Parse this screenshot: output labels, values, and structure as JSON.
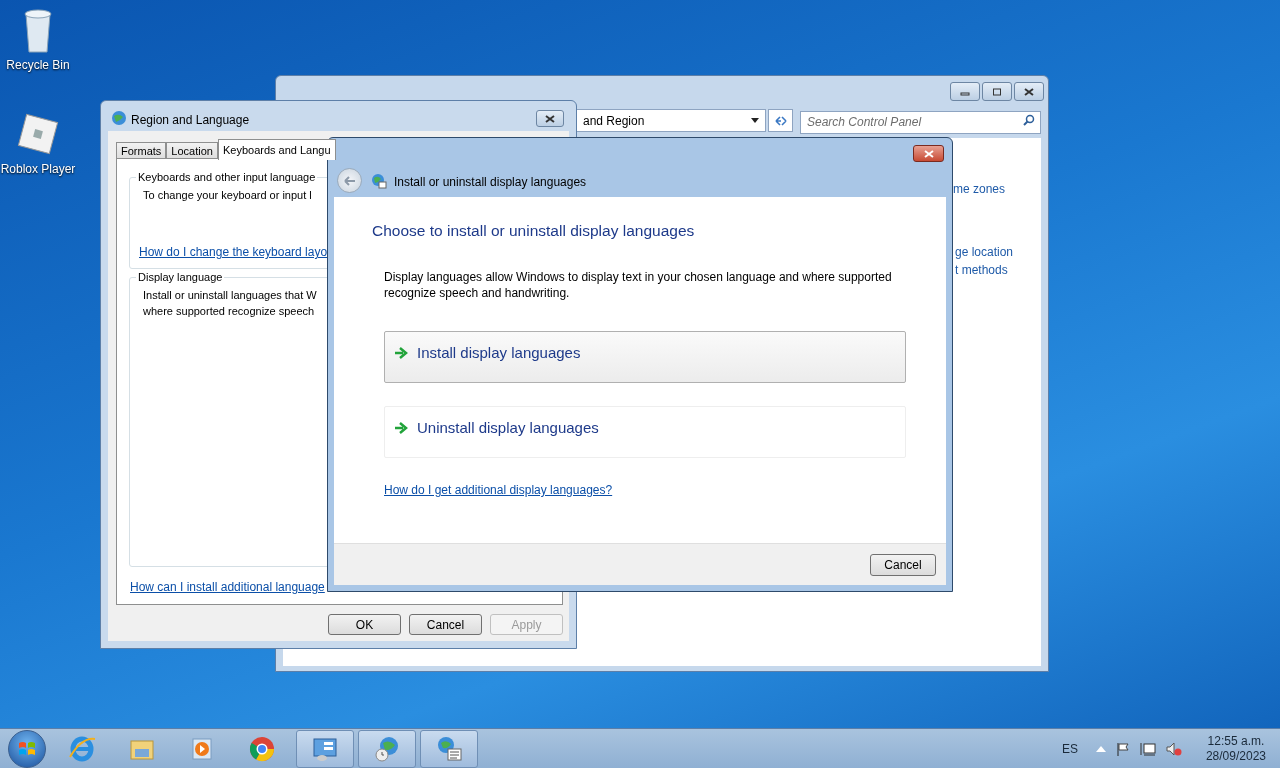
{
  "desktop_icons": [
    {
      "label": "Recycle Bin",
      "kind": "bin"
    },
    {
      "label": "Roblox Player",
      "kind": "roblox"
    }
  ],
  "control_panel": {
    "address": "and Region",
    "search_placeholder": "Search Control Panel",
    "links": [
      "me zones",
      "ge location",
      "t methods"
    ]
  },
  "region_dialog": {
    "title": "Region and Language",
    "tabs": [
      {
        "label": "Formats",
        "selected": false
      },
      {
        "label": "Location",
        "selected": false
      },
      {
        "label": "Keyboards and Langu",
        "selected": true
      }
    ],
    "groups": [
      {
        "heading": "Keyboards and other input language",
        "lines": [
          "To change your keyboard or input l"
        ],
        "link": "How do I change the keyboard layo"
      },
      {
        "heading": "Display language",
        "lines": [
          "Install or uninstall languages that W",
          "where supported recognize speech"
        ]
      }
    ],
    "link": "How can I install additional language",
    "buttons": [
      {
        "label": "OK",
        "disabled": false
      },
      {
        "label": "Cancel",
        "disabled": false
      },
      {
        "label": "Apply",
        "disabled": true
      }
    ]
  },
  "install_dialog": {
    "title": "Install or uninstall display languages",
    "heading": "Choose to install or uninstall display languages",
    "description": "Display languages allow Windows to display text in your chosen language and where supported recognize speech and handwriting.",
    "options": [
      {
        "label": "Install display languages",
        "hovered": true
      },
      {
        "label": "Uninstall display languages",
        "hovered": false
      }
    ],
    "link": "How do I get additional display languages?",
    "cancel": "Cancel"
  },
  "taskbar": {
    "language": "ES",
    "time": "12:55 a.m.",
    "date": "28/09/2023"
  }
}
